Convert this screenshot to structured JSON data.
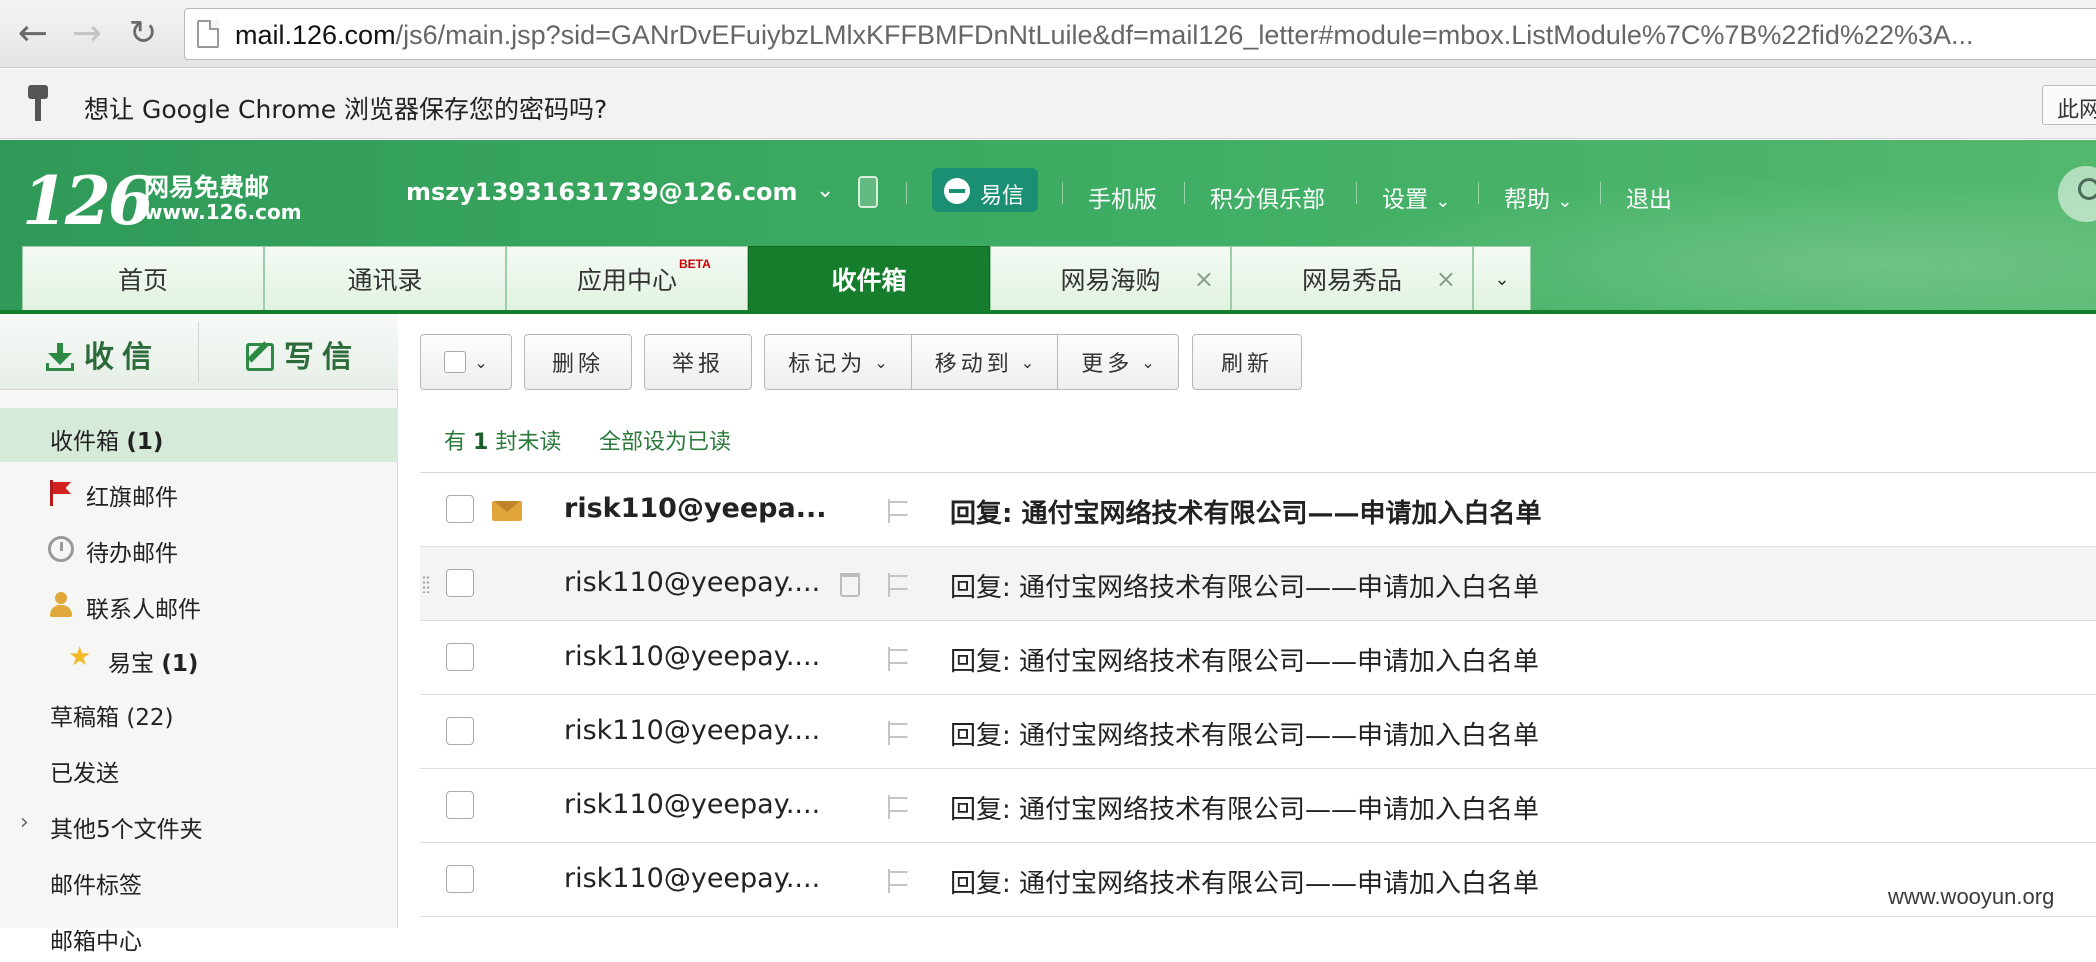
{
  "browser": {
    "url_host": "mail.126.com",
    "url_path": "/js6/main.jsp?sid=GANrDvEFuiybzLMlxKFFBMFDnNtLuile&df=mail126_letter#module=mbox.ListModule%7C%7B%22fid%22%3A...",
    "password_prompt": "想让 Google Chrome 浏览器保存您的密码吗?",
    "password_prompt_button": "此网"
  },
  "header": {
    "logo_number": "126",
    "logo_name": "网易免费邮",
    "logo_url": "www.126.com",
    "account": "mszy13931631739@126.com",
    "yixin_label": "易信",
    "links": [
      "手机版",
      "积分俱乐部",
      "设置",
      "帮助",
      "退出"
    ]
  },
  "tabs": [
    {
      "label": "首页"
    },
    {
      "label": "通讯录"
    },
    {
      "label": "应用中心",
      "badge": "BETA"
    },
    {
      "label": "收件箱"
    },
    {
      "label": "网易海购"
    },
    {
      "label": "网易秀品"
    }
  ],
  "sidebar": {
    "receive_label": "收信",
    "compose_label": "写信",
    "folders": [
      {
        "label": "收件箱",
        "count": "(1)"
      },
      {
        "label": "红旗邮件"
      },
      {
        "label": "待办邮件"
      },
      {
        "label": "联系人邮件"
      },
      {
        "label": "易宝",
        "count": "(1)"
      },
      {
        "label": "草稿箱",
        "count": "(22)"
      },
      {
        "label": "已发送"
      },
      {
        "label": "其他5个文件夹"
      },
      {
        "label": "邮件标签"
      },
      {
        "label": "邮箱中心"
      }
    ]
  },
  "toolbar": {
    "delete": "删除",
    "report": "举报",
    "mark_as": "标记为",
    "move_to": "移动到",
    "more": "更多",
    "refresh": "刷新"
  },
  "list_info": {
    "prefix": "有",
    "unread_count": "1",
    "suffix": "封未读",
    "mark_all_read": "全部设为已读"
  },
  "mails": [
    {
      "sender": "risk110@yeepa...",
      "subject": "回复: 通付宝网络技术有限公司——申请加入白名单",
      "unread": true
    },
    {
      "sender": "risk110@yeepay....",
      "subject": "回复: 通付宝网络技术有限公司——申请加入白名单",
      "unread": false
    },
    {
      "sender": "risk110@yeepay....",
      "subject": "回复: 通付宝网络技术有限公司——申请加入白名单",
      "unread": false
    },
    {
      "sender": "risk110@yeepay....",
      "subject": "回复: 通付宝网络技术有限公司——申请加入白名单",
      "unread": false
    },
    {
      "sender": "risk110@yeepay....",
      "subject": "回复: 通付宝网络技术有限公司——申请加入白名单",
      "unread": false
    },
    {
      "sender": "risk110@yeepay....",
      "subject": "回复: 通付宝网络技术有限公司——申请加入白名单",
      "unread": false
    }
  ],
  "watermark": "www.wooyun.org",
  "colors": {
    "brand_green": "#3fae64",
    "active_tab": "#157d2c",
    "sidebar_active": "#d6ead9"
  }
}
